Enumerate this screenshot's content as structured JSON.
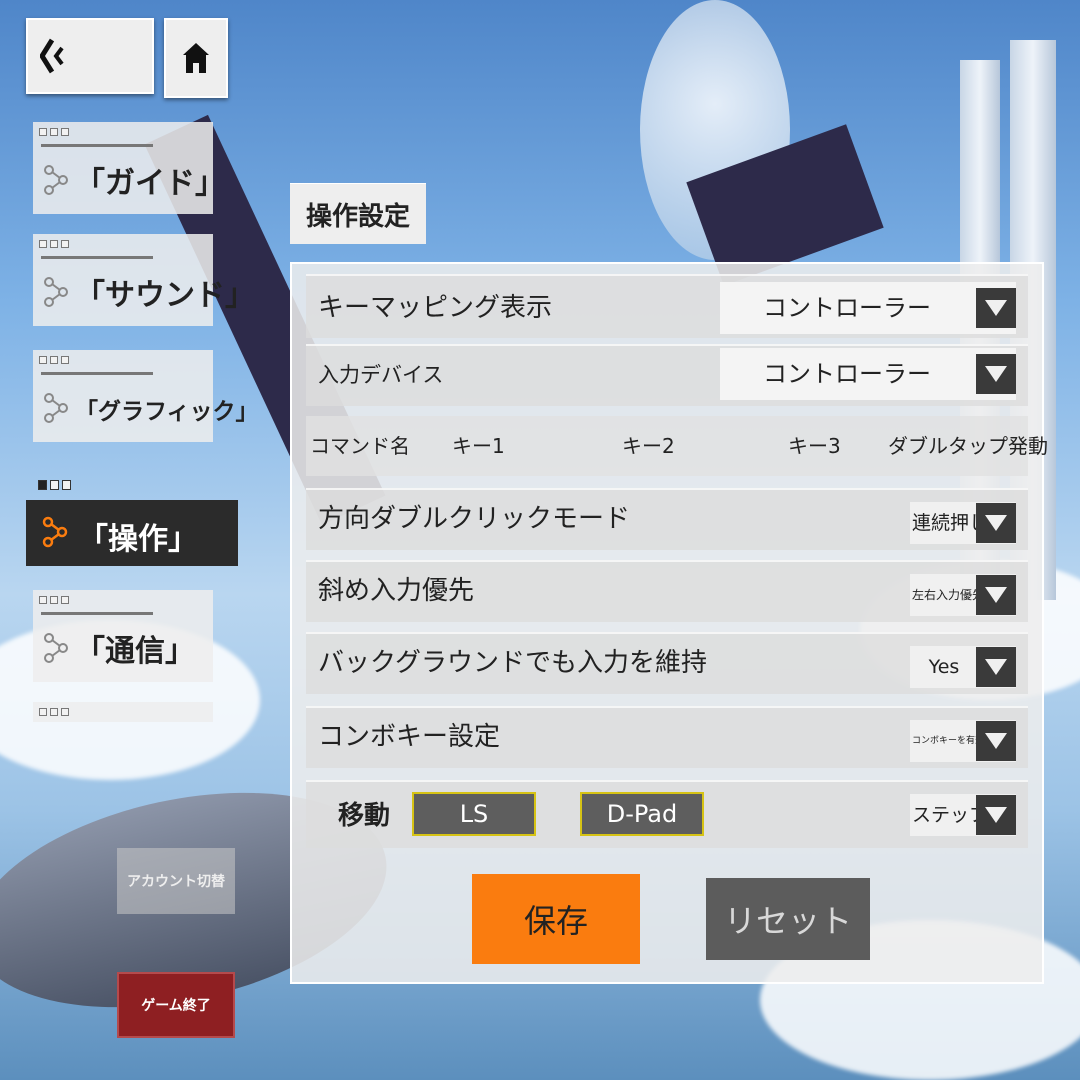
{
  "nav": {
    "items": [
      {
        "label": "「ガイド」"
      },
      {
        "label": "「サウンド」"
      },
      {
        "label": "「グラフィック」"
      },
      {
        "label": "「操作」"
      },
      {
        "label": "「通信」"
      }
    ],
    "account_button": "アカウント切替",
    "quit_button": "ゲーム終了"
  },
  "panel": {
    "tab_title": "操作設定",
    "key_mapping": {
      "label": "キーマッピング表示",
      "value": "コントローラー"
    },
    "input_device": {
      "label": "入力デバイス",
      "value": "コントローラー"
    },
    "table_header": {
      "col1": "コマンド名",
      "col2": "キー1",
      "col3": "キー2",
      "col4": "キー3",
      "col5": "ダブルタップ発動"
    },
    "rows": [
      {
        "label": "方向ダブルクリックモード",
        "value": "連続押し"
      },
      {
        "label": "斜め入力優先",
        "value": "左右入力優先"
      },
      {
        "label": "バックグラウンドでも入力を維持",
        "value": "Yes"
      },
      {
        "label": "コンボキー設定",
        "value": "コンボキーを有効化"
      }
    ],
    "move_row": {
      "label": "移動",
      "key1": "LS",
      "key2": "D-Pad",
      "value": "ステップ"
    },
    "save_button": "保存",
    "reset_button": "リセット"
  },
  "colors": {
    "accent": "#fa7c0f",
    "active_nav": "#2b2b2b",
    "quit": "#8e1f22",
    "key_border": "#d6c315"
  }
}
